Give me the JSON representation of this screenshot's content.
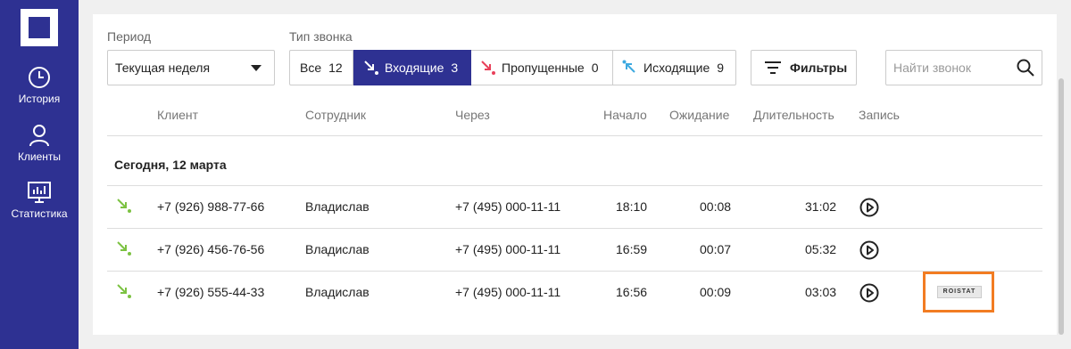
{
  "sidebar": {
    "items": [
      {
        "label": "История",
        "icon": "clock-icon"
      },
      {
        "label": "Клиенты",
        "icon": "user-icon"
      },
      {
        "label": "Статистика",
        "icon": "chart-icon"
      }
    ]
  },
  "filters": {
    "period_label": "Период",
    "period_value": "Текущая неделя",
    "call_type_label": "Тип звонка",
    "call_types": [
      {
        "label": "Все",
        "count": "12"
      },
      {
        "label": "Входящие",
        "count": "3"
      },
      {
        "label": "Пропущенные",
        "count": "0"
      },
      {
        "label": "Исходящие",
        "count": "9"
      }
    ],
    "filters_button": "Фильтры",
    "search_placeholder": "Найти звонок"
  },
  "table": {
    "headers": [
      "Клиент",
      "Сотрудник",
      "Через",
      "Начало",
      "Ожидание",
      "Длительность",
      "Запись"
    ],
    "group_label": "Сегодня, 12 марта",
    "rows": [
      {
        "client": "+7 (926) 988-77-66",
        "employee": "Владислав",
        "via": "+7 (495) 000-11-11",
        "start": "18:10",
        "wait": "00:08",
        "duration": "31:02"
      },
      {
        "client": "+7 (926) 456-76-56",
        "employee": "Владислав",
        "via": "+7 (495) 000-11-11",
        "start": "16:59",
        "wait": "00:07",
        "duration": "05:32"
      },
      {
        "client": "+7 (926) 555-44-33",
        "employee": "Владислав",
        "via": "+7 (495) 000-11-11",
        "start": "16:56",
        "wait": "00:09",
        "duration": "03:03",
        "tag": "ROISTAT"
      }
    ]
  },
  "colors": {
    "brand": "#2e3192",
    "incoming": "#7cc242",
    "missed": "#e8405a",
    "outgoing": "#3da9e0",
    "highlight": "#f27c22"
  }
}
